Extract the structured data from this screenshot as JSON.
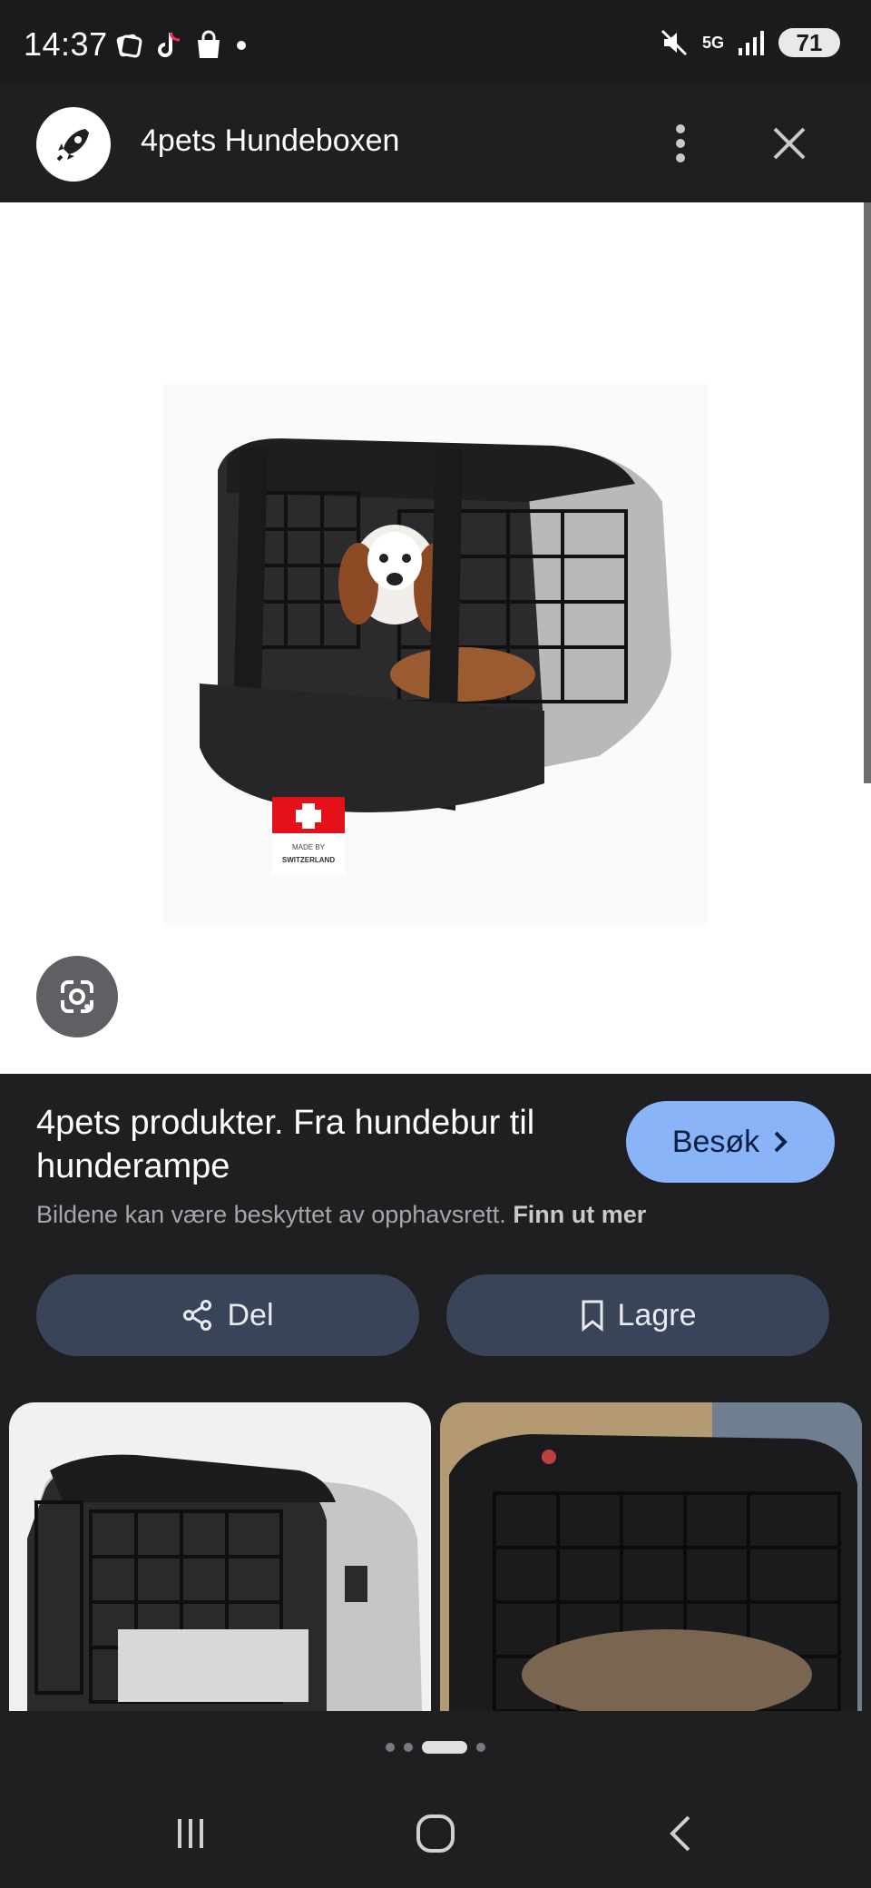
{
  "status_bar": {
    "time": "14:37",
    "left_icons": [
      "stack-icon",
      "tiktok-icon",
      "shopping-bag-icon",
      "dot-icon"
    ],
    "right_icons": [
      "mute-icon",
      "5g-icon",
      "signal-icon"
    ],
    "network": "5G",
    "battery": "71"
  },
  "header": {
    "title": "4pets Hundeboxen",
    "site_icon": "rocket-icon",
    "more_icon": "more-vert-icon",
    "close_icon": "close-icon"
  },
  "viewer": {
    "badge_text_1": "MADE BY",
    "badge_text_2": "SWITZERLAND",
    "lens_icon": "google-lens-icon"
  },
  "info": {
    "title": "4pets produkter. Fra hundebur til hunderampe",
    "visit_label": "Besøk",
    "copyright_text": "Bildene kan være beskyttet av opphavsrett.",
    "learn_more": "Finn ut mer",
    "share_label": "Del",
    "save_label": "Lagre"
  },
  "pager": {
    "count": 4,
    "active": 2
  },
  "navbar": {
    "recents_icon": "recents-icon",
    "home_icon": "home-icon",
    "back_icon": "back-icon"
  },
  "colors": {
    "background": "#1f1f21",
    "accent": "#8ab4f8",
    "button": "#3a4459"
  }
}
